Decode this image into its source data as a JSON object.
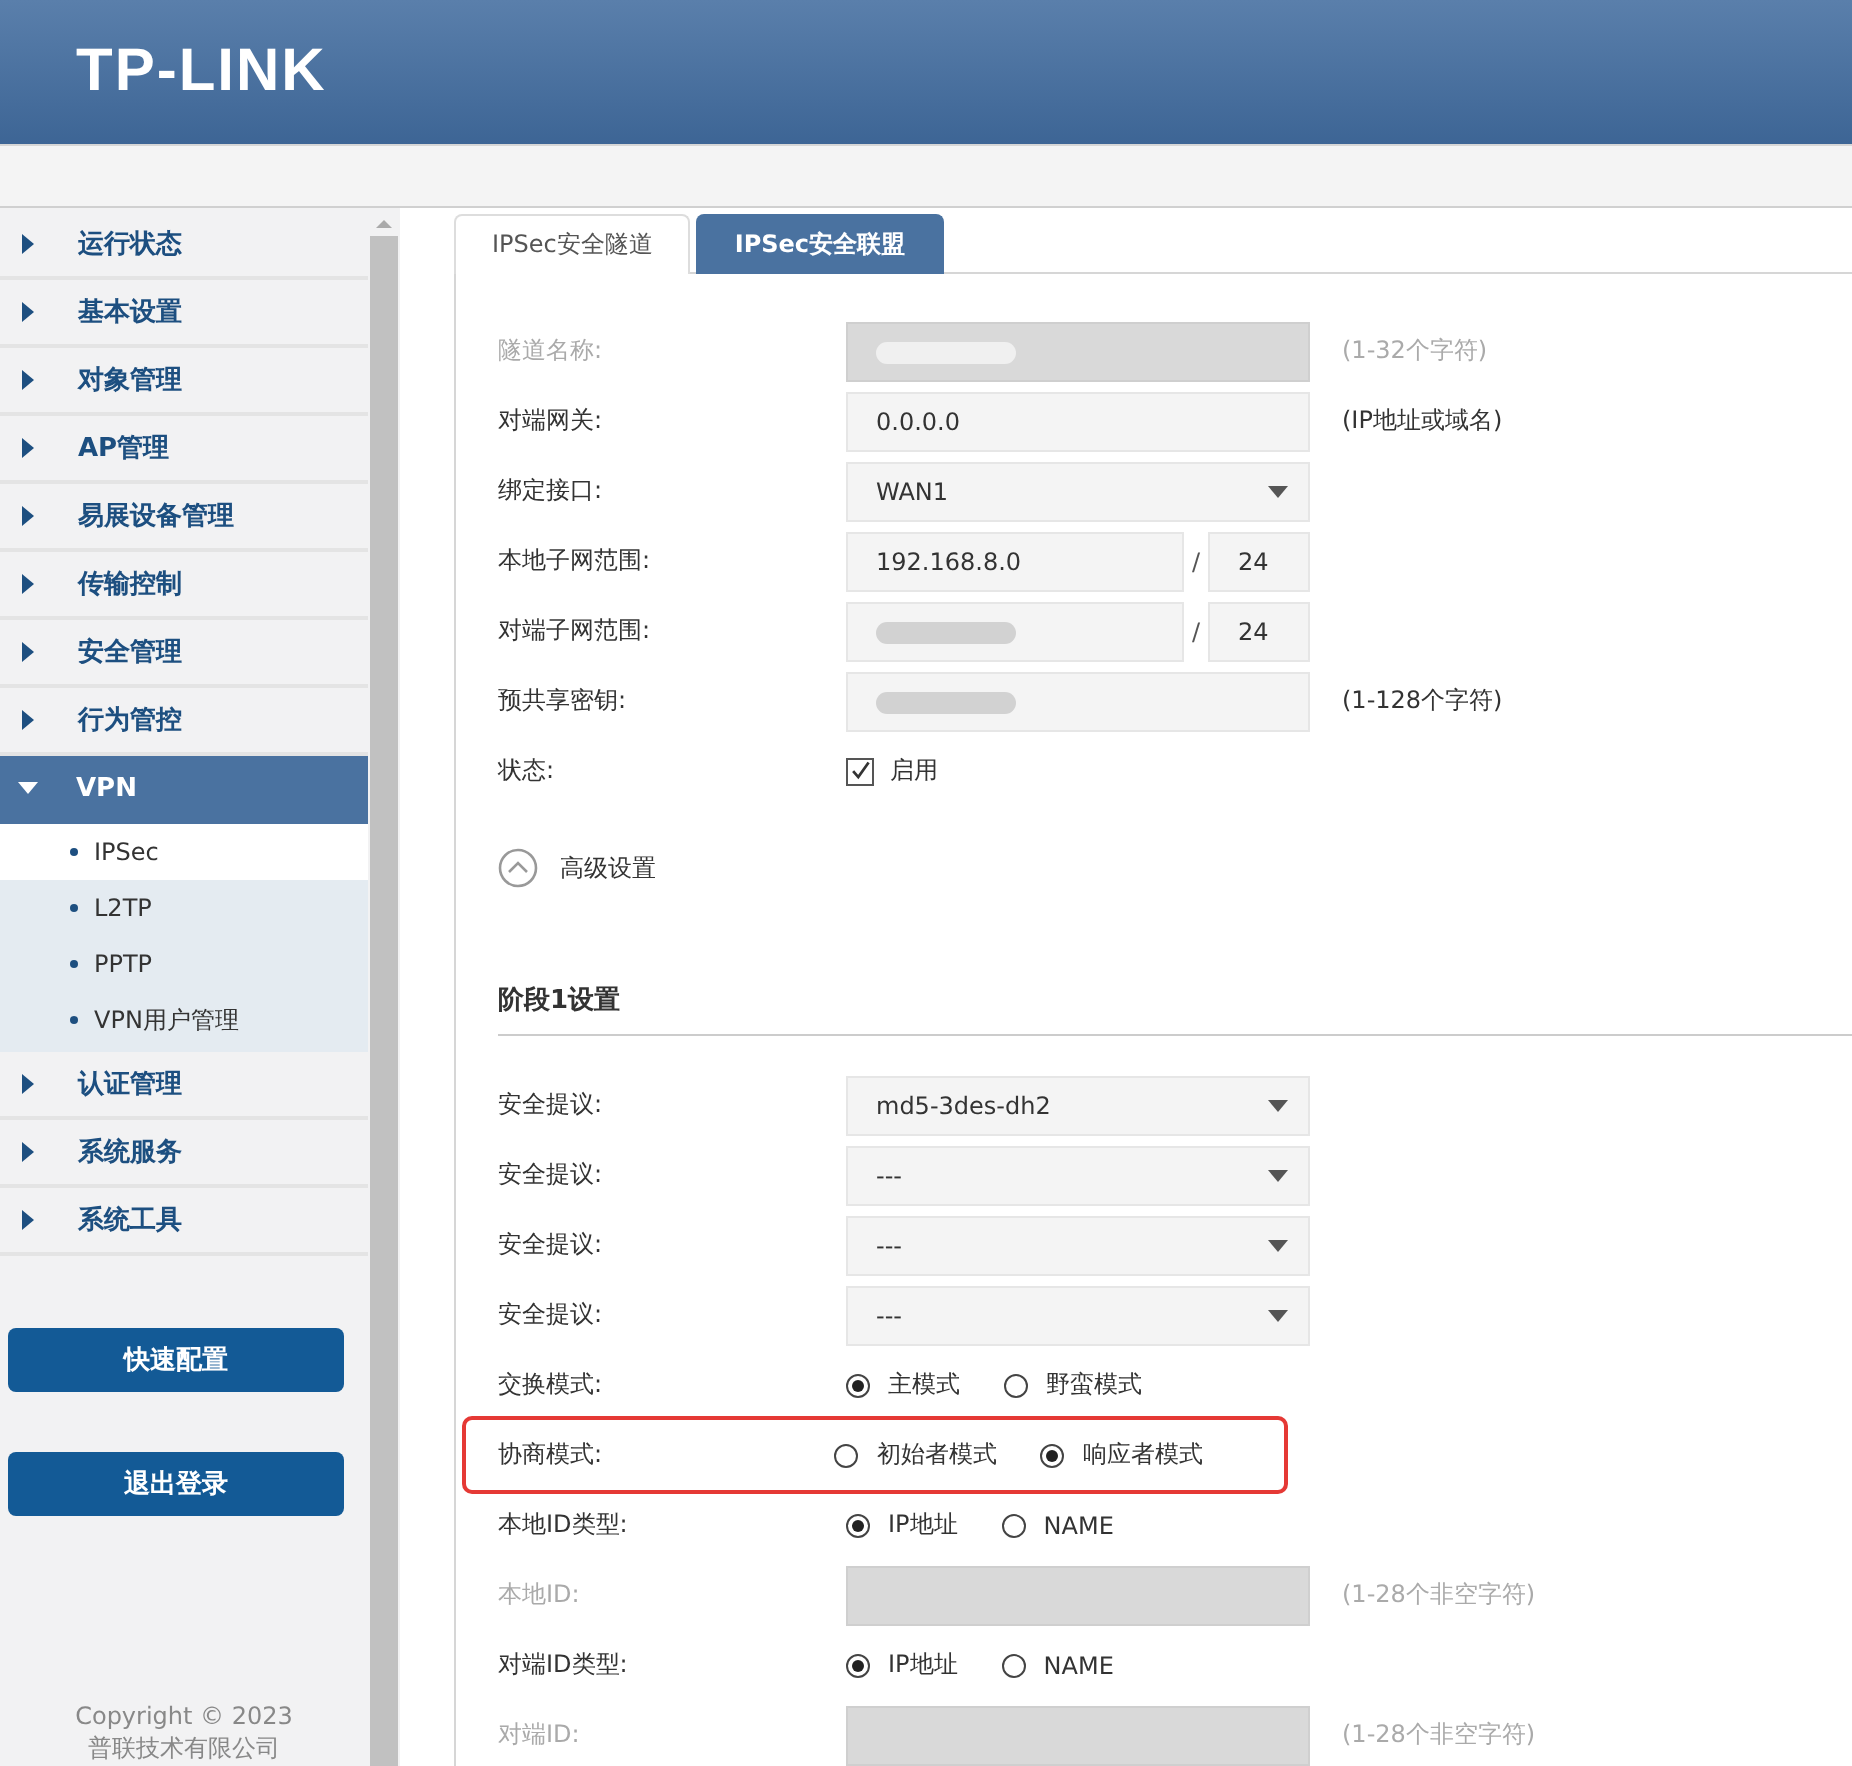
{
  "header": {
    "logo": "TP-LINK"
  },
  "sidebar": {
    "items": [
      {
        "label": "运行状态",
        "expanded": false
      },
      {
        "label": "基本设置",
        "expanded": false
      },
      {
        "label": "对象管理",
        "expanded": false
      },
      {
        "label": "AP管理",
        "expanded": false
      },
      {
        "label": "易展设备管理",
        "expanded": false
      },
      {
        "label": "传输控制",
        "expanded": false
      },
      {
        "label": "安全管理",
        "expanded": false
      },
      {
        "label": "行为管控",
        "expanded": false
      },
      {
        "label": "VPN",
        "expanded": true,
        "children": [
          {
            "label": "IPSec",
            "selected": true
          },
          {
            "label": "L2TP",
            "selected": false
          },
          {
            "label": "PPTP",
            "selected": false
          },
          {
            "label": "VPN用户管理",
            "selected": false
          }
        ]
      },
      {
        "label": "认证管理",
        "expanded": false
      },
      {
        "label": "系统服务",
        "expanded": false
      },
      {
        "label": "系统工具",
        "expanded": false
      }
    ],
    "buttons": [
      "快速配置",
      "退出登录"
    ],
    "copyright": [
      "Copyright © 2023",
      "普联技术有限公司"
    ]
  },
  "tabs": [
    {
      "label": "IPSec安全隧道",
      "selected": true
    },
    {
      "label": "IPSec安全联盟",
      "selected": false
    }
  ],
  "form": {
    "rows": [
      {
        "kind": "text",
        "label": "隧道名称:",
        "disabled": true,
        "redacted": true,
        "hint": "(1-32个字符)"
      },
      {
        "kind": "text",
        "label": "对端网关:",
        "disabled": false,
        "value": "0.0.0.0",
        "hint": "(IP地址或域名)"
      },
      {
        "kind": "select",
        "label": "绑定接口:",
        "value": "WAN1"
      },
      {
        "kind": "subnet",
        "label": "本地子网范围:",
        "value": "192.168.8.0",
        "separator": "/",
        "mask": "24"
      },
      {
        "kind": "subnet",
        "label": "对端子网范围:",
        "redacted": true,
        "separator": "/",
        "mask": "24"
      },
      {
        "kind": "text",
        "label": "预共享密钥:",
        "disabled": false,
        "redacted": true,
        "hint": "(1-128个字符)"
      },
      {
        "kind": "checkbox",
        "label": "状态:",
        "checked": true,
        "text": "启用"
      },
      {
        "kind": "toggle",
        "label": "高级设置",
        "expanded": true
      },
      {
        "kind": "heading",
        "label": "阶段1设置"
      },
      {
        "kind": "select",
        "label": "安全提议:",
        "value": "md5-3des-dh2"
      },
      {
        "kind": "select",
        "label": "安全提议:",
        "value": "---"
      },
      {
        "kind": "select",
        "label": "安全提议:",
        "value": "---"
      },
      {
        "kind": "select",
        "label": "安全提议:",
        "value": "---"
      },
      {
        "kind": "radio",
        "label": "交换模式:",
        "highlighted": false,
        "options": [
          {
            "label": "主模式",
            "selected": true
          },
          {
            "label": "野蛮模式",
            "selected": false
          }
        ]
      },
      {
        "kind": "radio",
        "label": "协商模式:",
        "highlighted": true,
        "options": [
          {
            "label": "初始者模式",
            "selected": false
          },
          {
            "label": "响应者模式",
            "selected": true
          }
        ]
      },
      {
        "kind": "radio",
        "label": "本地ID类型:",
        "highlighted": false,
        "options": [
          {
            "label": "IP地址",
            "selected": true
          },
          {
            "label": "NAME",
            "selected": false
          }
        ]
      },
      {
        "kind": "text",
        "label": "本地ID:",
        "disabled": true,
        "hint": "(1-28个非空字符)"
      },
      {
        "kind": "radio",
        "label": "对端ID类型:",
        "highlighted": false,
        "options": [
          {
            "label": "IP地址",
            "selected": true
          },
          {
            "label": "NAME",
            "selected": false
          }
        ]
      },
      {
        "kind": "text",
        "label": "对端ID:",
        "disabled": true,
        "hint": "(1-28个非空字符)"
      }
    ]
  }
}
